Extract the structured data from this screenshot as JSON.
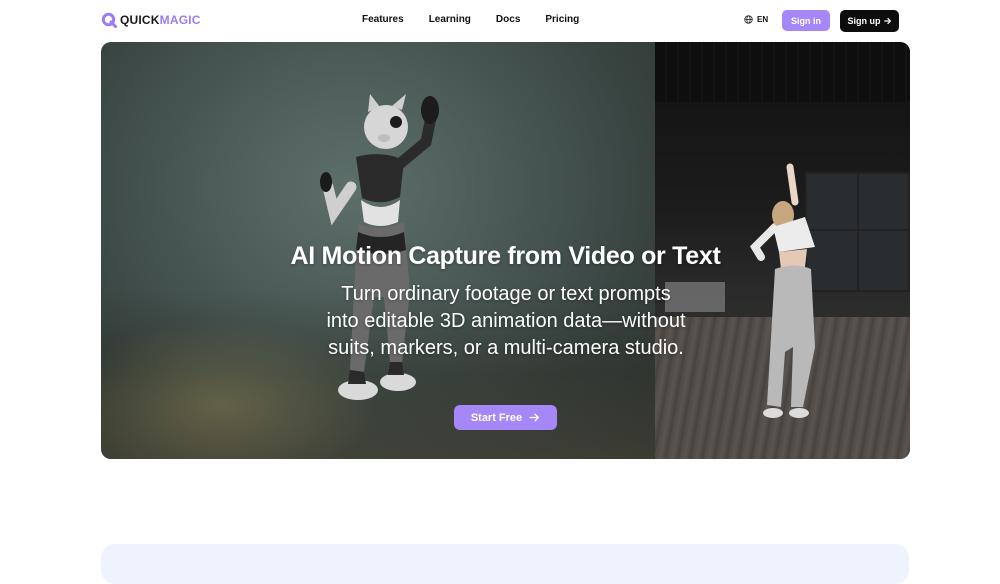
{
  "brand": {
    "part1": "QUICK",
    "part2": "MAGIC",
    "accent": "#9b7cf4"
  },
  "nav": {
    "items": [
      {
        "label": "Features"
      },
      {
        "label": "Learning"
      },
      {
        "label": "Docs"
      },
      {
        "label": "Pricing"
      }
    ],
    "language": {
      "icon": "globe-icon",
      "label": "EN"
    },
    "signin_label": "Sign in",
    "signup_label": "Sign up",
    "signup_icon": "arrow-right-icon"
  },
  "hero": {
    "title": "AI Motion Capture from Video or Text",
    "subtitle": "Turn ordinary footage or text prompts into editable 3D animation data—without suits, markers, or a multi-camera studio.",
    "cta_label": "Start Free",
    "cta_icon": "arrow-right-icon"
  },
  "colors": {
    "primary": "#a587f7",
    "dark": "#0d0d0d",
    "card": "#eef3fd"
  }
}
